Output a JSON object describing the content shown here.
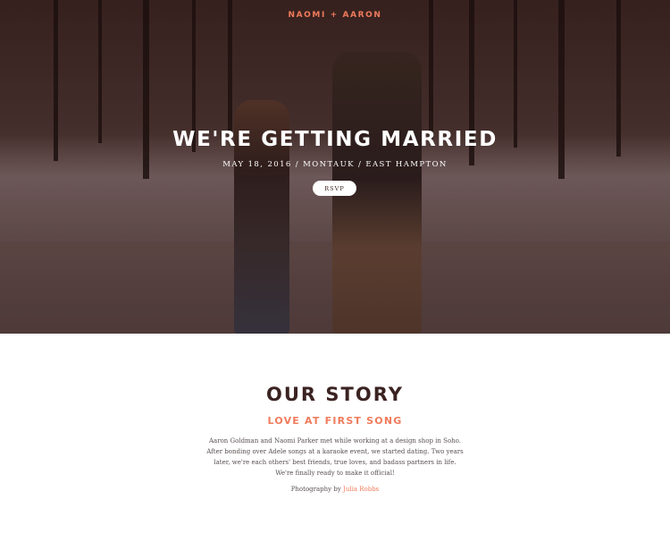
{
  "header": {
    "brand": "NAOMI + AARON"
  },
  "hero": {
    "title": "WE'RE GETTING MARRIED",
    "subtitle": "MAY 18, 2016 / MONTAUK / EAST HAMPTON",
    "rsvp_label": "RSVP"
  },
  "story": {
    "title": "OUR STORY",
    "subtitle": "LOVE AT FIRST SONG",
    "body_lines": [
      "Aaron Goldman and Naomi Parker met while working at a design shop in Soho.",
      "After bonding over Adele songs at a karaoke event, we started dating. Two years",
      "later, we're each others' best friends, true loves, and badass partners in life.",
      "We're finally ready to make it official!"
    ],
    "credit_prefix": "Photography by",
    "credit_name": "Julia Robbs"
  },
  "colors": {
    "accent": "#f07b5c",
    "heading": "#3b2322",
    "hero_overlay": "#3a2420"
  }
}
